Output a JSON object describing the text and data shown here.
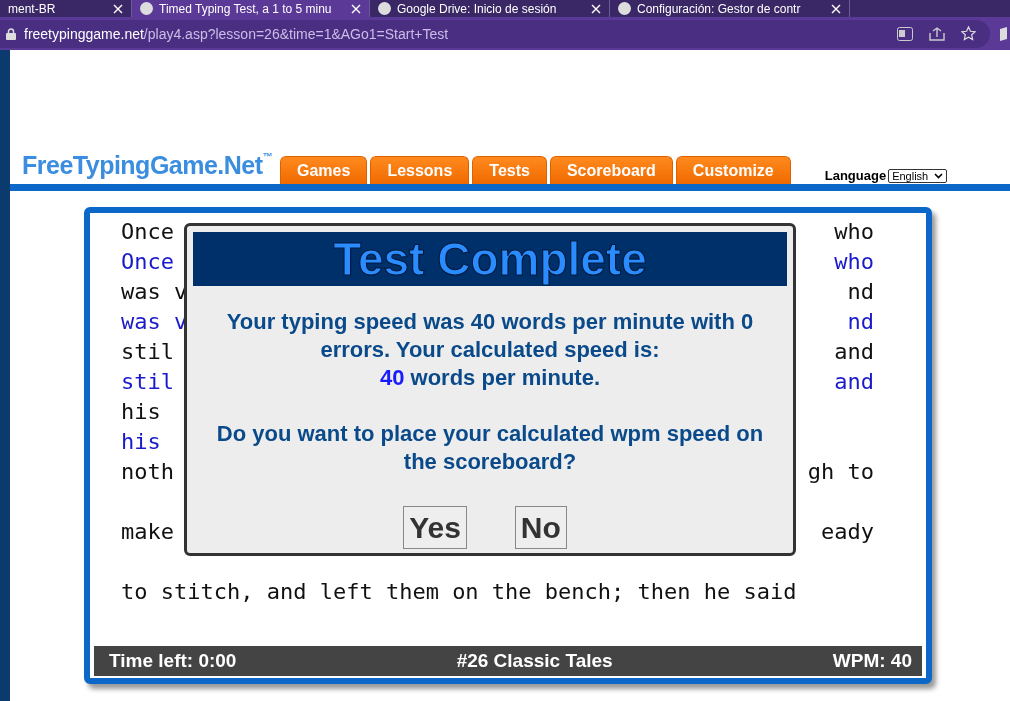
{
  "browser": {
    "tabs": [
      {
        "title": "ment-BR",
        "selected": false
      },
      {
        "title": "Timed Typing Test, a 1 to 5 minu",
        "selected": true
      },
      {
        "title": "Google Drive: Inicio de sesión",
        "selected": false
      },
      {
        "title": "Configuración: Gestor de contr",
        "selected": false
      }
    ],
    "url_host": "freetypinggame.net",
    "url_path": "/play4.asp?lesson=26&time=1&AGo1=Start+Test"
  },
  "site": {
    "logo": "FreeTypingGame.Net",
    "logo_mark": "™",
    "nav": [
      "Games",
      "Lessons",
      "Tests",
      "Scoreboard",
      "Customize"
    ],
    "language_label": "Language",
    "language_value": "English"
  },
  "typing": {
    "lines": [
      {
        "kind": "text",
        "left": "Once",
        "right": "who",
        "typed": false
      },
      {
        "kind": "text",
        "left": "Once",
        "right": "who",
        "typed": true
      },
      {
        "kind": "text",
        "left": "was v",
        "right": "nd",
        "typed": false
      },
      {
        "kind": "text",
        "left": "was v",
        "right": "nd",
        "typed": true
      },
      {
        "kind": "text",
        "left": "stil",
        "right": "and",
        "typed": false
      },
      {
        "kind": "text",
        "left": "stil",
        "right": "and",
        "typed": true
      },
      {
        "kind": "text",
        "left": "his",
        "typed": false
      },
      {
        "kind": "text",
        "left": "his",
        "typed": true
      },
      {
        "kind": "text",
        "left": "noth",
        "right": "gh to",
        "typed": false
      },
      {
        "kind": "blank"
      },
      {
        "kind": "text",
        "left": "make",
        "right": "eady",
        "typed": false
      },
      {
        "kind": "blank"
      },
      {
        "kind": "text",
        "left": "to stitch, and left them on the bench; then he said",
        "typed": false
      }
    ],
    "status": {
      "time_left": "Time left: 0:00",
      "lesson": "#26 Classic Tales",
      "wpm": "WPM: 40"
    }
  },
  "dialog": {
    "title": "Test Complete",
    "result_text": "Your typing speed was 40 words per minute with 0 errors. Your calculated speed is:",
    "calculated_wpm": "40",
    "calculated_unit": "words per minute.",
    "question": "Do you want to place your calculated wpm speed on the scoreboard?",
    "buttons": [
      "Yes",
      "No"
    ]
  }
}
